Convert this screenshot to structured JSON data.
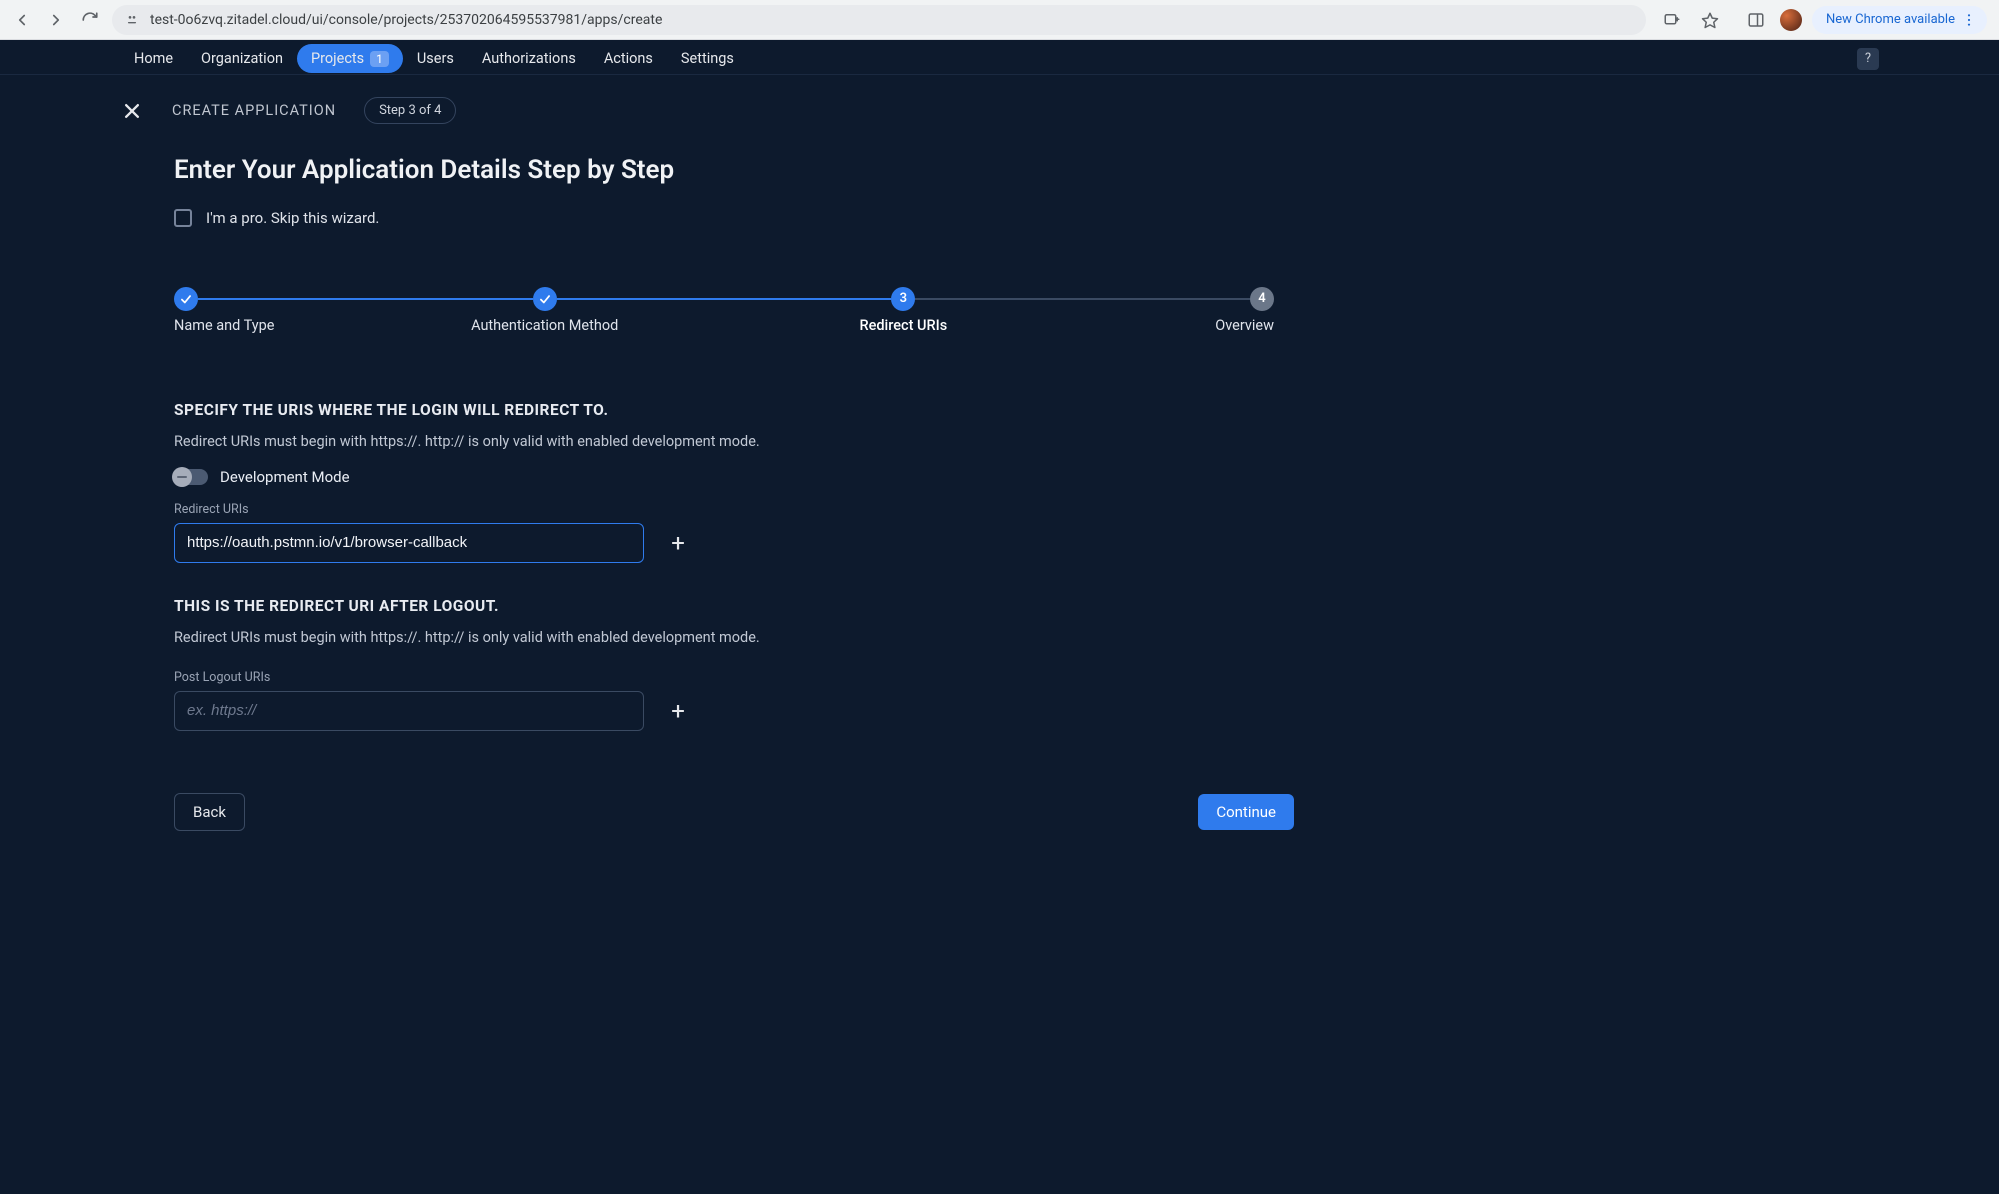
{
  "browser": {
    "url": "test-0o6zvq.zitadel.cloud/ui/console/projects/253702064595537981/apps/create",
    "new_chrome_label": "New Chrome available"
  },
  "nav": {
    "items": [
      {
        "label": "Home"
      },
      {
        "label": "Organization"
      },
      {
        "label": "Projects",
        "badge": "1",
        "active": true
      },
      {
        "label": "Users"
      },
      {
        "label": "Authorizations"
      },
      {
        "label": "Actions"
      },
      {
        "label": "Settings"
      }
    ],
    "help": "?"
  },
  "header": {
    "title": "CREATE APPLICATION",
    "step_pill": "Step 3 of 4"
  },
  "page": {
    "h1": "Enter Your Application Details Step by Step",
    "skip_label": "I'm a pro. Skip this wizard."
  },
  "stepper": {
    "steps": [
      {
        "label": "Name and Type",
        "state": "completed"
      },
      {
        "label": "Authentication Method",
        "state": "completed"
      },
      {
        "label": "Redirect URIs",
        "state": "current",
        "number": "3"
      },
      {
        "label": "Overview",
        "state": "inactive",
        "number": "4"
      }
    ]
  },
  "redirect_section": {
    "title": "SPECIFY THE URIS WHERE THE LOGIN WILL REDIRECT TO.",
    "desc": "Redirect URIs must begin with https://. http:// is only valid with enabled development mode.",
    "dev_toggle_label": "Development Mode",
    "field_caption": "Redirect URIs",
    "field_value": "https://oauth.pstmn.io/v1/browser-callback"
  },
  "logout_section": {
    "title": "THIS IS THE REDIRECT URI AFTER LOGOUT.",
    "desc": "Redirect URIs must begin with https://. http:// is only valid with enabled development mode.",
    "field_caption": "Post Logout URIs",
    "field_placeholder": "ex. https://"
  },
  "footer": {
    "back": "Back",
    "continue": "Continue"
  }
}
